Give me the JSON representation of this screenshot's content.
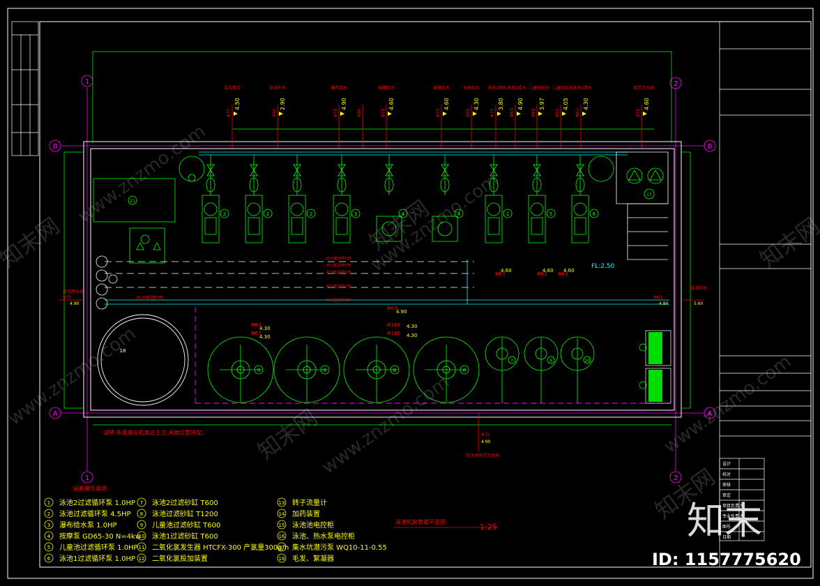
{
  "drawing": {
    "title": "泳池机房管道平面图",
    "scale": "1:25",
    "note": "说明:热泵放在机房正上方,具体位置待定。",
    "floor_level": "FL:2.50",
    "legend_heading": "设备编号说明"
  },
  "axes": {
    "one": "1",
    "two": "2",
    "a": "A",
    "b": "B",
    "left_b": "B"
  },
  "pipe_labels_top": [
    {
      "name": "溢流排污",
      "dn": "Φ75",
      "elev": "4.50"
    },
    {
      "name": "泳池补水",
      "dn": "Φ90",
      "elev": "2.90"
    },
    {
      "name": "瀑布给水",
      "dn": "Φ75",
      "elev": "4.90"
    },
    {
      "name": "",
      "dn": "Φ90",
      "elev": ""
    },
    {
      "name": "按摩回水",
      "dn": "Φ75",
      "elev": "4.60"
    },
    {
      "name": "按摩给水",
      "dn": "Φ75",
      "elev": "4.60"
    },
    {
      "name": "泳池给水",
      "dn": "Φ90",
      "elev": "4.30"
    },
    {
      "name": "泳池2回水",
      "dn": "Φ75",
      "elev": "3.80"
    },
    {
      "name": "泳池2给水",
      "dn": "Φ63",
      "elev": "4.90"
    },
    {
      "name": "儿童池回水",
      "dn": "Φ63",
      "elev": "3.97"
    },
    {
      "name": "儿童池给水",
      "dn": "Φ63",
      "elev": "4.05"
    },
    {
      "name": "泳池1回水",
      "dn": "Φ63",
      "elev": "4.30"
    },
    {
      "name": "排至污水井",
      "dn": "Φ75",
      "elev": "4.60"
    }
  ],
  "side_labels": {
    "left_top": "排至雨水井",
    "left_dn": "Φ75",
    "left_elev": "4.90",
    "right_top": "溢流回水",
    "right_dn": "Φ63",
    "right_elev": "4.90",
    "right_elev2": "5.60",
    "bottom": "至冰池排至污水井",
    "bottom_dn": "Φ75",
    "bottom_elev": "4.90"
  },
  "mid_labels": [
    {
      "dn": "Φ63",
      "elev": "4.90"
    },
    {
      "dn": "Φ63",
      "elev": "4.30"
    },
    {
      "dn": "Φ160",
      "elev": "4.30"
    },
    {
      "dn": "Φ160",
      "elev": "4.30"
    },
    {
      "dn": "Φ63",
      "elev": "4.30"
    },
    {
      "dn": "Φ63",
      "elev": "4.60"
    },
    {
      "dn": "Φ63",
      "elev": "4.60"
    },
    {
      "dn": "Φ63",
      "elev": "4.60"
    }
  ],
  "legend": [
    {
      "no": "1",
      "text": "泳池2过滤循环泵 1.0HP"
    },
    {
      "no": "2",
      "text": "泳池过滤循环泵 4.5HP"
    },
    {
      "no": "3",
      "text": "瀑布给水泵 1.0HP"
    },
    {
      "no": "4",
      "text": "按摩泵 GD65-30 N=4kw"
    },
    {
      "no": "5",
      "text": "儿童池过滤循环泵 1.0HP"
    },
    {
      "no": "6",
      "text": "泳池1过滤循环泵 1.0HP"
    },
    {
      "no": "7",
      "text": "泳池2过滤砂缸 T600"
    },
    {
      "no": "8",
      "text": "泳池过滤砂缸 T1200"
    },
    {
      "no": "9",
      "text": "儿童池过滤砂缸 T600"
    },
    {
      "no": "10",
      "text": "泳池1过滤砂缸 T600"
    },
    {
      "no": "11",
      "text": "二氧化氯发生器 HTCFX-300 产氯量300g/h"
    },
    {
      "no": "12",
      "text": "二氧化氯投加装置"
    },
    {
      "no": "13",
      "text": "转子流量计"
    },
    {
      "no": "14",
      "text": "加药装置"
    },
    {
      "no": "15",
      "text": "泳池池电控柜"
    },
    {
      "no": "16",
      "text": "泳池、热水泵电控柜"
    },
    {
      "no": "17",
      "text": "集水坑潜污泵 WQ10-11-0.55"
    },
    {
      "no": "18",
      "text": "毛发、絮凝器"
    }
  ],
  "equipment_numbers": {
    "pumps_top": [
      "2",
      "2",
      "2",
      "3",
      "4",
      "4",
      "1",
      "5",
      "6"
    ],
    "filters_big": [
      "8",
      "8",
      "8",
      "8"
    ],
    "filters_small": [
      "7",
      "9",
      "10"
    ],
    "tank": "18",
    "box": "11",
    "sump": "17",
    "panels": [
      "15",
      "16"
    ]
  },
  "title_block": {
    "rows": [
      "设计",
      "校对",
      "审核",
      "审定",
      "项目负责人",
      "专业负责人",
      "图号",
      "日期"
    ]
  },
  "watermark": {
    "site": "www.znzmo.com",
    "brand_cn": "知末网",
    "logo": "知末",
    "id_text": "ID: 1157775620"
  },
  "colors": {
    "background": "#000000",
    "frame": "#ffffff",
    "equipment": "#00ff00",
    "pipe_cyan": "#00ffff",
    "pipe_red": "#ff0000",
    "grid_magenta": "#ff00ff",
    "text_yellow": "#ffff00",
    "panel_green": "#00dd00"
  }
}
